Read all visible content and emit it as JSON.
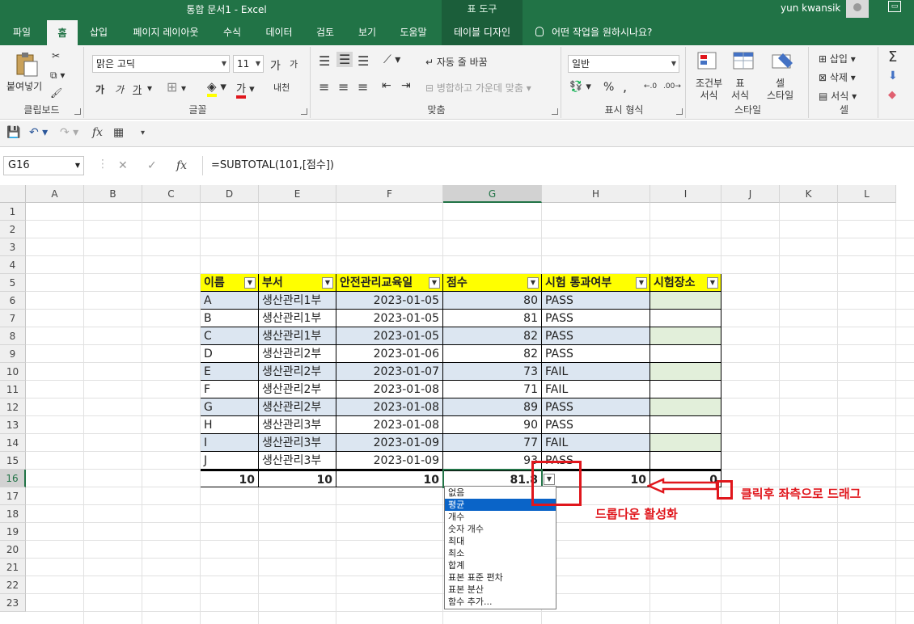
{
  "window": {
    "title": "통합 문서1  -  Excel",
    "context_tool": "표 도구",
    "user": "yun kwansik"
  },
  "tabs": [
    "파일",
    "홈",
    "삽입",
    "페이지 레이아웃",
    "수식",
    "데이터",
    "검토",
    "보기",
    "도움말",
    "테이블 디자인"
  ],
  "tell_me": "어떤 작업을 원하시나요?",
  "ribbon": {
    "clipboard": {
      "paste": "붙여넣기",
      "label": "클립보드"
    },
    "font": {
      "name": "맑은 고딕",
      "size": "11",
      "label": "글꼴",
      "size_up": "가",
      "size_down": "가",
      "bold": "가",
      "italic": "가",
      "underline": "가",
      "fontcolor": "가",
      "phonetic": "내천"
    },
    "align": {
      "wrap": "자동 줄 바꿈",
      "merge": "병합하고 가운데 맞춤",
      "label": "맞춤"
    },
    "number": {
      "format": "일반",
      "label": "표시 형식",
      "percent": "%",
      "comma": ","
    },
    "styles": {
      "cond": [
        "조건부",
        "서식"
      ],
      "table": [
        "표",
        "서식"
      ],
      "cell": [
        "셀",
        "스타일"
      ],
      "label": "스타일"
    },
    "cells": {
      "insert": "삽입",
      "delete": "삭제",
      "format": "서식",
      "label": "셀"
    }
  },
  "formula_bar": {
    "name_box": "G16",
    "formula": "=SUBTOTAL(101,[점수])",
    "fx": "fx"
  },
  "columns": [
    "A",
    "B",
    "C",
    "D",
    "E",
    "F",
    "G",
    "H",
    "I",
    "J",
    "K",
    "L"
  ],
  "rows": [
    "1",
    "2",
    "3",
    "4",
    "5",
    "6",
    "7",
    "8",
    "9",
    "10",
    "11",
    "12",
    "13",
    "14",
    "15",
    "16",
    "17",
    "18",
    "19",
    "20",
    "21",
    "22",
    "23"
  ],
  "table": {
    "headers": [
      "이름",
      "부서",
      "안전관리교육일",
      "점수",
      "시험 통과여부",
      "시험장소"
    ],
    "rows": [
      [
        "A",
        "생산관리1부",
        "2023-01-05",
        "80",
        "PASS",
        ""
      ],
      [
        "B",
        "생산관리1부",
        "2023-01-05",
        "81",
        "PASS",
        ""
      ],
      [
        "C",
        "생산관리1부",
        "2023-01-05",
        "82",
        "PASS",
        ""
      ],
      [
        "D",
        "생산관리2부",
        "2023-01-06",
        "82",
        "PASS",
        ""
      ],
      [
        "E",
        "생산관리2부",
        "2023-01-07",
        "73",
        "FAIL",
        ""
      ],
      [
        "F",
        "생산관리2부",
        "2023-01-08",
        "71",
        "FAIL",
        ""
      ],
      [
        "G",
        "생산관리2부",
        "2023-01-08",
        "89",
        "PASS",
        ""
      ],
      [
        "H",
        "생산관리3부",
        "2023-01-08",
        "90",
        "PASS",
        ""
      ],
      [
        "I",
        "생산관리3부",
        "2023-01-09",
        "77",
        "FAIL",
        ""
      ],
      [
        "J",
        "생산관리3부",
        "2023-01-09",
        "93",
        "PASS",
        ""
      ]
    ],
    "totals": [
      "10",
      "10",
      "10",
      "81.8",
      "10",
      "0"
    ]
  },
  "dropdown": [
    "없음",
    "평균",
    "개수",
    "숫자 개수",
    "최대",
    "최소",
    "합계",
    "표본 표준 편차",
    "표본 분산",
    "함수 추가..."
  ],
  "dropdown_selected": "평균",
  "annotations": {
    "drag": "클릭후 좌측으로 드래그",
    "dropdown": "드롭다운 활성화"
  },
  "colors": {
    "accent": "#217346",
    "header_fill": "#ffff00",
    "band": "#dce6f1",
    "annotation": "#e0161c"
  }
}
